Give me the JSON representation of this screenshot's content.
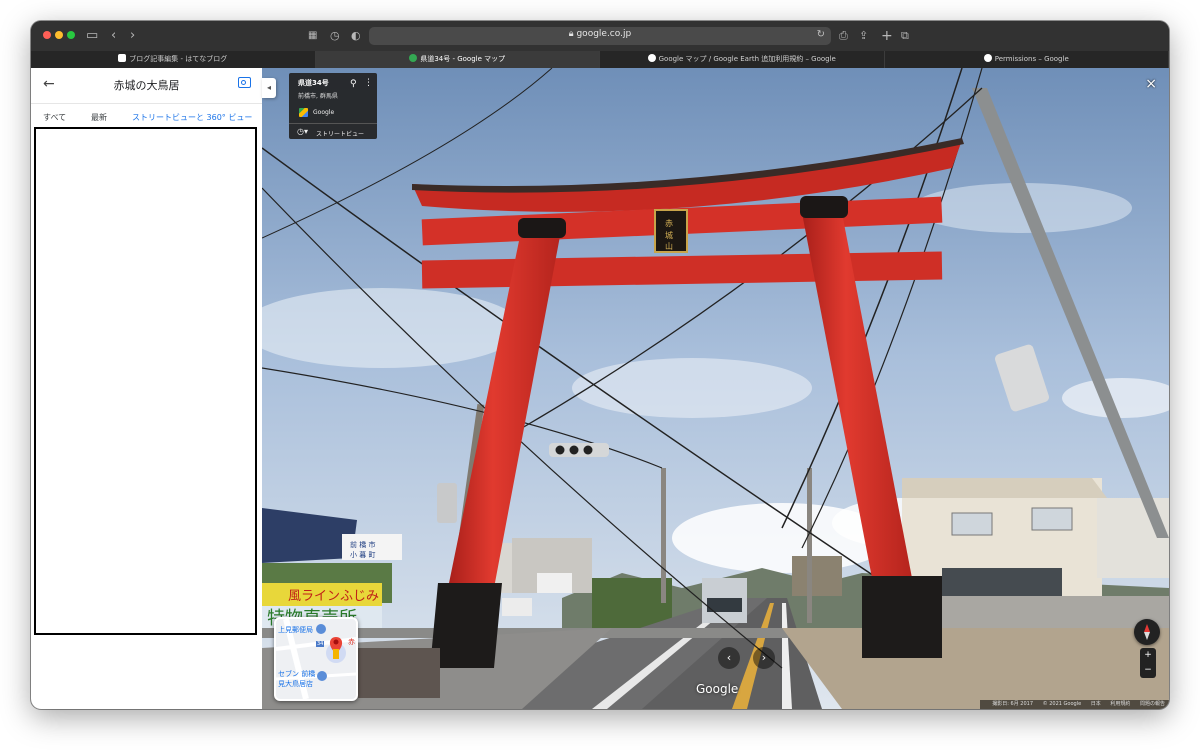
{
  "browser": {
    "url": "google.co.jp",
    "tabs": [
      {
        "label": "ブログ記事編集 - はてなブログ",
        "favicon_color": "#ffffff",
        "active": false
      },
      {
        "label": "県道34号 - Google マップ",
        "favicon_color": "#34a853",
        "active": true
      },
      {
        "label": "Google マップ / Google Earth 追加利用規約 – Google",
        "favicon_color": "#ffffff",
        "active": false
      },
      {
        "label": "Permissions – Google",
        "favicon_color": "#ffffff",
        "active": false
      }
    ]
  },
  "panel": {
    "title": "赤城の大鳥居",
    "filters": {
      "all": "すべて",
      "latest": "最新",
      "streetview": "ストリートビューと 360° ビュー"
    },
    "collapse_icon": "◂"
  },
  "streetview": {
    "info": {
      "road": "県道34号",
      "location": "前橋市, 群馬県",
      "brand": "Google",
      "mode_label": "ストリートビュー"
    },
    "close": "×",
    "minimap": {
      "labels": [
        "上見郵便局",
        "セブン 前橋",
        "見大鳥居店"
      ],
      "route_badge": "34",
      "pin_side_label": "赤"
    },
    "watermark": "Google",
    "zoom_in": "+",
    "zoom_out": "−",
    "footer": {
      "capture_date": "撮影日: 6月 2017",
      "copyright": "© 2021 Google",
      "country": "日本",
      "terms": "利用規約",
      "report": "問題の報告"
    },
    "signs": {
      "shop_banner_1": "風ラインふじみ",
      "shop_banner_2": "特物直売所",
      "city_sign": "前 橋 市",
      "city_sign_2": "小 暮 町"
    }
  },
  "colors": {
    "torii_red": "#d8312a",
    "accent_blue": "#1a73e8",
    "sky": "#9fb6d3"
  }
}
